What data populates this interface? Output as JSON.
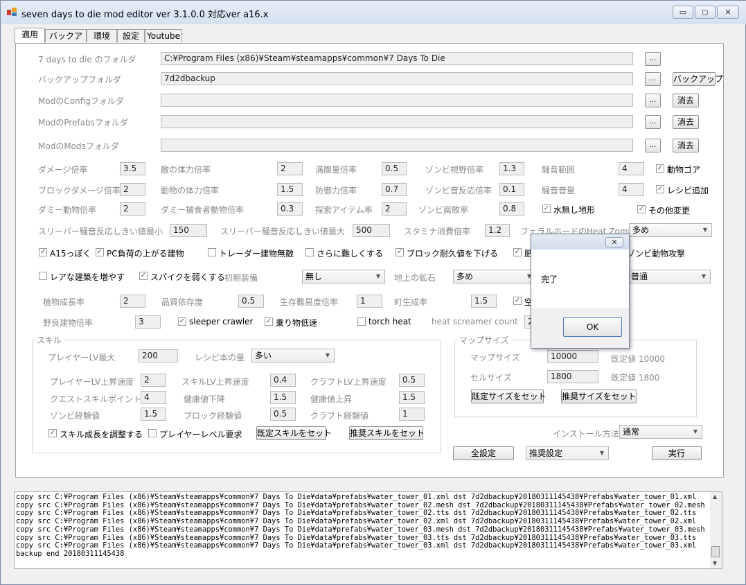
{
  "window": {
    "title": "seven days to die mod editor ver 3.1.0.0 対応ver a16.x",
    "minimize": "▭",
    "maximize": "◻",
    "close": "✕"
  },
  "tabs": [
    {
      "label": "適用"
    },
    {
      "label": "バックアップ"
    },
    {
      "label": "環境"
    },
    {
      "label": "設定"
    },
    {
      "label": "Youtube"
    }
  ],
  "folders": {
    "game_label": "7 days to die のフォルダ",
    "game_value": "C:¥Program Files (x86)¥Steam¥steamapps¥common¥7 Days To Die",
    "backup_label": "バックアップフォルダ",
    "backup_value": "7d2dbackup",
    "backup_button": "バックアップ",
    "config_label": "ModのConfigフォルダ",
    "prefabs_label": "ModのPrefabsフォルダ",
    "mods_label": "ModのModsフォルダ",
    "browse": "...",
    "clear": "消去"
  },
  "rates": {
    "damage_label": "ダメージ倍率",
    "damage": "3.5",
    "enemy_hp_label": "敵の体力倍率",
    "enemy_hp": "2",
    "hunger_label": "満腹量倍率",
    "hunger": "0.5",
    "zombie_view_label": "ゾンビ視野倍率",
    "zombie_view": "1.3",
    "noise_range_label": "騒音範囲",
    "noise_range": "4",
    "animal_gore_label": "動物ゴア",
    "block_damage_label": "ブロックダメージ倍率",
    "block_damage": "2",
    "animal_hp_label": "動物の体力倍率",
    "animal_hp": "1.5",
    "defense_label": "防御力倍率",
    "defense": "0.7",
    "zombie_sound_label": "ゾンビ音反応倍率",
    "zombie_sound": "0.1",
    "noise_volume_label": "騒音音量",
    "noise_volume": "4",
    "recipe_add_label": "レシピ追加",
    "dummy_animal_label": "ダミー動物倍率",
    "dummy_animal": "2",
    "dummy_predator_label": "ダミー捕食者動物倍率",
    "dummy_predator": "0.3",
    "search_item_label": "探索アイテム率",
    "search_item": "2",
    "zombie_rot_label": "ゾンビ腐敗率",
    "zombie_rot": "0.8",
    "waterless_label": "水無し地形",
    "other_changes_label": "その他変更",
    "sleeper_min_label": "スリーパー騒音反応しきい値最小",
    "sleeper_min": "150",
    "sleeper_max_label": "スリーパー騒音反応しきい値最大",
    "sleeper_max": "500",
    "stamina_label": "スタミナ消費倍率",
    "stamina": "1.2",
    "feral_label": "フェラルホードのHeat Zombie量",
    "feral": "多め"
  },
  "options": {
    "a15_label": "A15っぽく",
    "pc_load_label": "PC負荷の上がる建物",
    "trader_label": "トレーダー建物無敵",
    "harder_label": "さらに難しくする",
    "block_dur_label": "ブロック耐久値を下げる",
    "fertile_label": "肥",
    "zombie_animal_label": "ゾンビ動物攻撃",
    "rare_build_label": "レアな建築を増やす",
    "spike_label": "スパイクを弱くする",
    "initial_equip_label": "初期装備",
    "initial_equip": "無し",
    "ground_ore_label": "地上の鉱石",
    "ground_ore": "多め",
    "extra_select": "普通",
    "plant_growth_label": "植物成長率",
    "plant_growth": "2",
    "quality_label": "品質依存度",
    "quality": "0.5",
    "survival_label": "生存難易度倍率",
    "survival": "1",
    "town_gen_label": "町生成率",
    "town_gen": "1.5",
    "sky_label": "空",
    "wild_bldg_label": "野良建物倍率",
    "wild_bldg": "3",
    "sleeper_crawler_label": "sleeper crawler",
    "vehicle_label": "乗り物低速",
    "torch_label": "torch heat",
    "screamer_label": "heat screamer count",
    "screamer": "2"
  },
  "skill": {
    "group_label": "スキル",
    "player_lv_max_label": "プレイヤーLV最大",
    "player_lv_max": "200",
    "recipe_books_label": "レシピ本の量",
    "recipe_books": "多い",
    "player_lv_speed_label": "プレイヤーLV上昇速度",
    "player_lv_speed": "2",
    "skill_lv_speed_label": "スキルLV上昇速度",
    "skill_lv_speed": "0.4",
    "craft_lv_speed_label": "クラフトLV上昇速度",
    "craft_lv_speed": "0.5",
    "quest_points_label": "クエストスキルポイント",
    "quest_points": "4",
    "health_down_label": "健康値下降",
    "health_down": "1.5",
    "health_up_label": "健康値上昇",
    "health_up": "1.5",
    "zombie_xp_label": "ゾンビ経験値",
    "zombie_xp": "1.5",
    "block_xp_label": "ブロック経験値",
    "block_xp": "0.5",
    "craft_xp_label": "クラフト経験値",
    "craft_xp": "1",
    "adjust_label": "スキル成長を調整する",
    "player_level_req_label": "プレイヤーレベル要求",
    "default_skill_btn": "既定スキルをセット",
    "recommended_skill_btn": "推奨スキルをセット"
  },
  "map": {
    "group_label": "マップサイズ",
    "map_size_label": "マップサイズ",
    "map_size": "10000",
    "map_default": "既定値 10000",
    "cell_size_label": "セルサイズ",
    "cell_size": "1800",
    "cell_default": "既定値 1800",
    "default_size_btn": "既定サイズをセット",
    "recommended_size_btn": "推奨サイズをセット"
  },
  "install": {
    "method_label": "インストール方法",
    "method": "通常",
    "all_settings_btn": "全設定",
    "preset": "推奨設定",
    "run_btn": "実行"
  },
  "log": [
    "copy src C:¥Program Files (x86)¥Steam¥steamapps¥common¥7 Days To Die¥data¥prefabs¥water_tower_01.xml dst 7d2dbackup¥20180311145438¥Prefabs¥water_tower_01.xml",
    "copy src C:¥Program Files (x86)¥Steam¥steamapps¥common¥7 Days To Die¥data¥prefabs¥water_tower_02.mesh dst 7d2dbackup¥20180311145438¥Prefabs¥water_tower_02.mesh",
    "copy src C:¥Program Files (x86)¥Steam¥steamapps¥common¥7 Days To Die¥data¥prefabs¥water_tower_02.tts dst 7d2dbackup¥20180311145438¥Prefabs¥water_tower_02.tts",
    "copy src C:¥Program Files (x86)¥Steam¥steamapps¥common¥7 Days To Die¥data¥prefabs¥water_tower_02.xml dst 7d2dbackup¥20180311145438¥Prefabs¥water_tower_02.xml",
    "copy src C:¥Program Files (x86)¥Steam¥steamapps¥common¥7 Days To Die¥data¥prefabs¥water_tower_03.mesh dst 7d2dbackup¥20180311145438¥Prefabs¥water_tower_03.mesh",
    "copy src C:¥Program Files (x86)¥Steam¥steamapps¥common¥7 Days To Die¥data¥prefabs¥water_tower_03.tts dst 7d2dbackup¥20180311145438¥Prefabs¥water_tower_03.tts",
    "copy src C:¥Program Files (x86)¥Steam¥steamapps¥common¥7 Days To Die¥data¥prefabs¥water_tower_03.xml dst 7d2dbackup¥20180311145438¥Prefabs¥water_tower_03.xml",
    "backup end 20180311145438"
  ],
  "dialog": {
    "close": "✕",
    "message": "完了",
    "ok": "OK"
  },
  "colors": {
    "accent": "#3c7fb1",
    "panel_bg": "#ffffff",
    "window_bg": "#f0f0f0"
  },
  "icons": {
    "check": "✓",
    "arrow_down": "▼",
    "arrow_up": "▲"
  }
}
